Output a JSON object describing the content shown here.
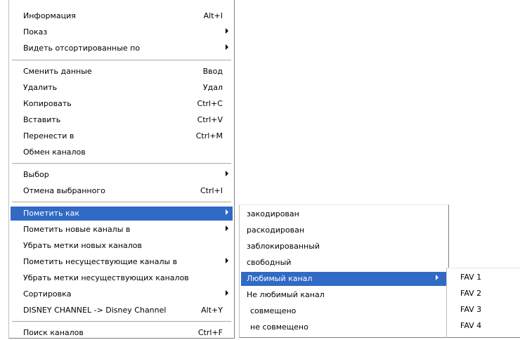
{
  "main_menu": {
    "info": {
      "label": "Информация",
      "shortcut": "Alt+I"
    },
    "show": {
      "label": "Показ"
    },
    "sort_view": {
      "label": "Видеть отсортированные по"
    },
    "change_data": {
      "label": "Сменить данные",
      "shortcut": "Ввод"
    },
    "delete": {
      "label": "Удалить",
      "shortcut": "Удал"
    },
    "copy": {
      "label": "Копировать",
      "shortcut": "Ctrl+C"
    },
    "paste": {
      "label": "Вставить",
      "shortcut": "Ctrl+V"
    },
    "move_to": {
      "label": "Перенести в",
      "shortcut": "Ctrl+M"
    },
    "swap_channels": {
      "label": "Обмен каналов"
    },
    "select": {
      "label": "Выбор"
    },
    "cancel_selection": {
      "label": "Отмена выбранного",
      "shortcut": "Ctrl+I"
    },
    "mark_as": {
      "label": "Пометить как"
    },
    "mark_new_channels": {
      "label": "Пометить новые каналы в"
    },
    "remove_new_marks": {
      "label": "Убрать метки новых каналов"
    },
    "mark_missing_channels": {
      "label": "Пометить несуществующие каналы в"
    },
    "remove_missing_marks": {
      "label": "Убрать метки несуществующих каналов"
    },
    "sorting": {
      "label": "Сортировка"
    },
    "rename_disney": {
      "label": "DISNEY CHANNEL -> Disney Channel",
      "shortcut": "Alt+Y"
    },
    "search_channels": {
      "label": "Поиск каналов",
      "shortcut": "Ctrl+F"
    }
  },
  "mark_as_submenu": {
    "encoded": "закодирован",
    "decoded": "раскодирован",
    "locked": "заблокированный",
    "free": "свободный",
    "favorite": "Любимый канал",
    "not_favorite": "Не любимый канал",
    "matched": "совмещено",
    "not_matched": "не совмещено"
  },
  "favorite_submenu": {
    "fav1": "FAV 1",
    "fav2": "FAV 2",
    "fav3": "FAV 3",
    "fav4": "FAV 4"
  },
  "colors": {
    "highlight": "#316ac5",
    "separator": "#aca899",
    "menu_background": "#ffffff"
  }
}
